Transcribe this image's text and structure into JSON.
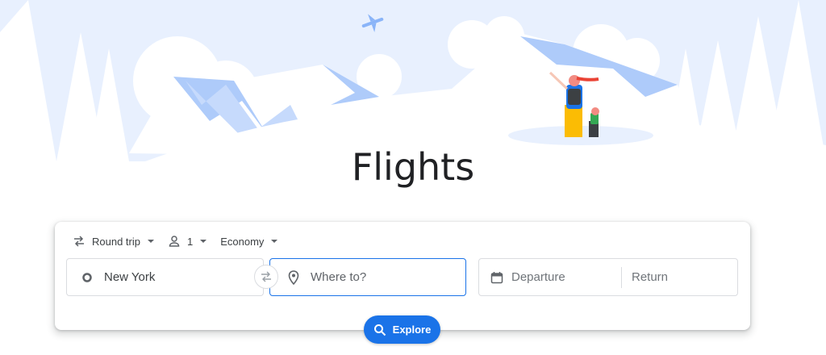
{
  "page": {
    "title": "Flights"
  },
  "trip_options": {
    "trip_type": "Round trip",
    "passengers": "1",
    "cabin_class": "Economy"
  },
  "search": {
    "from_value": "New York",
    "to_placeholder": "Where to?",
    "departure_placeholder": "Departure",
    "return_placeholder": "Return"
  },
  "explore_button": {
    "label": "Explore"
  },
  "colors": {
    "accent": "#1a73e8",
    "mountain_blue": "#aecbfa",
    "sky": "#e8f0fe"
  },
  "icons": {
    "trip_type": "swap-horiz-icon",
    "passengers": "person-icon",
    "origin": "circle-outline-icon",
    "destination": "location-pin-icon",
    "date": "calendar-icon",
    "explore": "search-icon"
  }
}
